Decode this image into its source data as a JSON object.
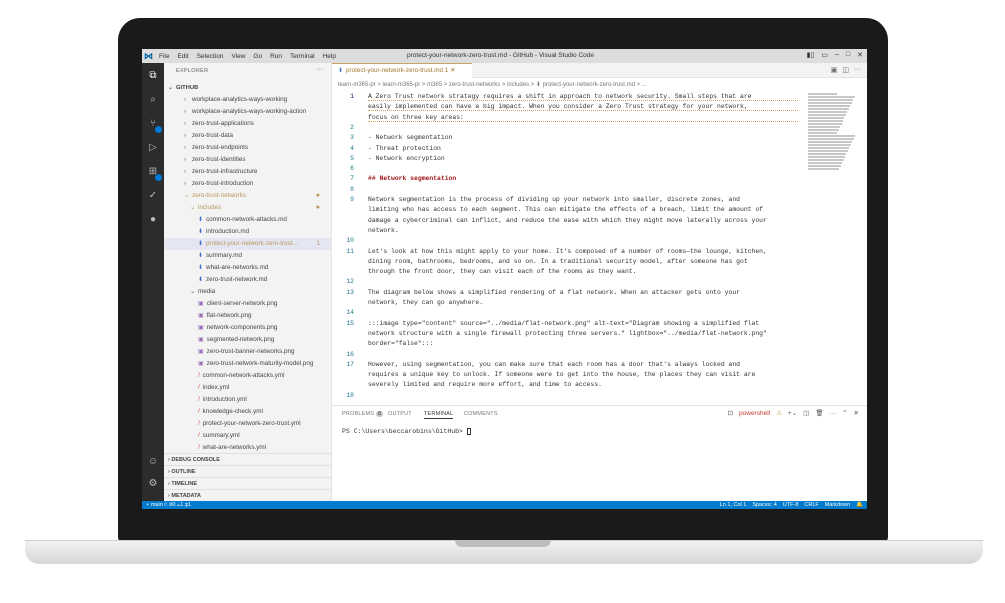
{
  "window_title": "protect-your-network-zero-trust.md - GitHub - Visual Studio Code",
  "menu": [
    "File",
    "Edit",
    "Selection",
    "View",
    "Go",
    "Run",
    "Terminal",
    "Help"
  ],
  "sidebar": {
    "header": "EXPLORER",
    "root": "GITHUB",
    "items": [
      {
        "label": "workplace-analytics-ways-working",
        "type": "folder"
      },
      {
        "label": "workplace-analytics-ways-working-action",
        "type": "folder"
      },
      {
        "label": "zero-trust-applications",
        "type": "folder"
      },
      {
        "label": "zero-trust-data",
        "type": "folder"
      },
      {
        "label": "zero-trust-endpoints",
        "type": "folder"
      },
      {
        "label": "zero-trust-identities",
        "type": "folder"
      },
      {
        "label": "zero-trust-infrastructure",
        "type": "folder"
      },
      {
        "label": "zero-trust-introduction",
        "type": "folder"
      }
    ],
    "open_folder": "zero-trust-networks",
    "includes": "includes",
    "include_files": [
      "common-network-attacks.md",
      "introduction.md",
      "protect-your-network-zero-trust...",
      "summary.md",
      "what-are-networks.md",
      "zero-trust-network.md"
    ],
    "selected_badge": "1",
    "media": "media",
    "media_files": [
      "client-server-network.png",
      "flat-network.png",
      "network-components.png",
      "segmented-network.png",
      "zero-trust-banner-networks.png",
      "zero-trust-network-maturity-model.png"
    ],
    "yml_files": [
      "common-network-attacks.yml",
      "index.yml",
      "introduction.yml",
      "knowledge-check.yml",
      "protect-your-network-zero-trust.yml",
      "summary.yml",
      "what-are-networks.yml"
    ],
    "sections": [
      "DEBUG CONSOLE",
      "OUTLINE",
      "TIMELINE",
      "METADATA"
    ]
  },
  "editor": {
    "tab": "protect-your-network-zero-trust.md 1",
    "breadcrumb": "learn-m365-pr > learn-m365-pr > m365 > zero-trust-networks > includes > ⬇ protect-your-network-zero-trust.md > ...",
    "lines": [
      {
        "n": "1",
        "text": "A Zero Trust network strategy requires a shift in approach to network security. Small steps that are"
      },
      {
        "n": "",
        "text": "easily implemented can have a big impact. When you consider a Zero Trust strategy for your network,"
      },
      {
        "n": "",
        "text": "focus on three key areas:"
      },
      {
        "n": "2",
        "text": ""
      },
      {
        "n": "3",
        "text": "- Network segmentation"
      },
      {
        "n": "4",
        "text": "- Threat protection"
      },
      {
        "n": "5",
        "text": "- Network encryption"
      },
      {
        "n": "6",
        "text": ""
      },
      {
        "n": "7",
        "text": "## Network segmentation"
      },
      {
        "n": "8",
        "text": ""
      },
      {
        "n": "9",
        "text": "Network segmentation is the process of dividing up your network into smaller, discrete zones, and"
      },
      {
        "n": "",
        "text": "limiting who has access to each segment. This can mitigate the effects of a breach, limit the amount of"
      },
      {
        "n": "",
        "text": "damage a cybercriminal can inflict, and reduce the ease with which they might move laterally across your"
      },
      {
        "n": "",
        "text": "network."
      },
      {
        "n": "10",
        "text": ""
      },
      {
        "n": "11",
        "text": "Let's look at how this might apply to your home. It's composed of a number of rooms—the lounge, kitchen,"
      },
      {
        "n": "",
        "text": "dining room, bathrooms, bedrooms, and so on. In a traditional security model, after someone has got"
      },
      {
        "n": "",
        "text": "through the front door, they can visit each of the rooms as they want."
      },
      {
        "n": "12",
        "text": ""
      },
      {
        "n": "13",
        "text": "The diagram below shows a simplified rendering of a flat network. When an attacker gets onto your"
      },
      {
        "n": "",
        "text": "network, they can go anywhere."
      },
      {
        "n": "14",
        "text": ""
      },
      {
        "n": "15",
        "text": ":::image type=\"content\" source=\"../media/flat-network.png\" alt-text=\"Diagram showing a simplified flat"
      },
      {
        "n": "",
        "text": "network structure with a single firewall protecting three servers.\" lightbox=\"../media/flat-network.png\""
      },
      {
        "n": "",
        "text": "border=\"false\":::"
      },
      {
        "n": "16",
        "text": ""
      },
      {
        "n": "17",
        "text": "However, using segmentation, you can make sure that each room has a door that's always locked and"
      },
      {
        "n": "",
        "text": "requires a unique key to unlock. If someone were to get into the house, the places they can visit are"
      },
      {
        "n": "",
        "text": "severely limited and require more effort, and time to access."
      },
      {
        "n": "18",
        "text": ""
      }
    ]
  },
  "panel": {
    "tabs": [
      "PROBLEMS",
      "OUTPUT",
      "TERMINAL",
      "COMMENTS"
    ],
    "problems_count": "8",
    "active_tab": "TERMINAL",
    "shell": "powershell",
    "prompt": "PS C:\\Users\\beccarobins\\GitHub> "
  },
  "colors": {
    "accent": "#007acc",
    "modified": "#b8975a",
    "activity_bar": "#2c2c2c"
  }
}
